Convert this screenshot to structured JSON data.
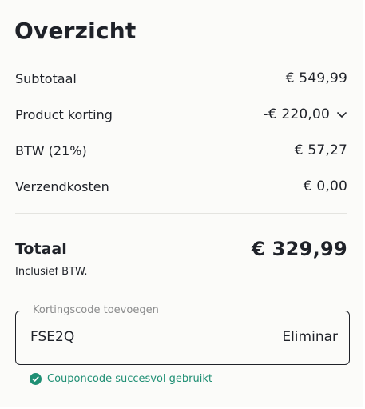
{
  "overview": {
    "title": "Overzicht",
    "rows": [
      {
        "label": "Subtotaal",
        "value": "€ 549,99"
      },
      {
        "label": "Product korting",
        "value": "-€ 220,00"
      },
      {
        "label": "BTW (21%)",
        "value": "€ 57,27"
      },
      {
        "label": "Verzendkosten",
        "value": "€ 0,00"
      }
    ],
    "total": {
      "label": "Totaal",
      "value": "€ 329,99",
      "note": "Inclusief BTW."
    }
  },
  "coupon": {
    "legend": "Kortingscode toevoegen",
    "code": "FSE2Q",
    "remove_label": "Eliminar",
    "success_text": "Couponcode succesvol gebruikt"
  },
  "icons": {
    "discount_toggle": "chevron-down-icon",
    "success": "check-circle-icon"
  },
  "colors": {
    "text": "#1f2229",
    "success": "#1f8f74",
    "muted": "#8a8b8c"
  }
}
